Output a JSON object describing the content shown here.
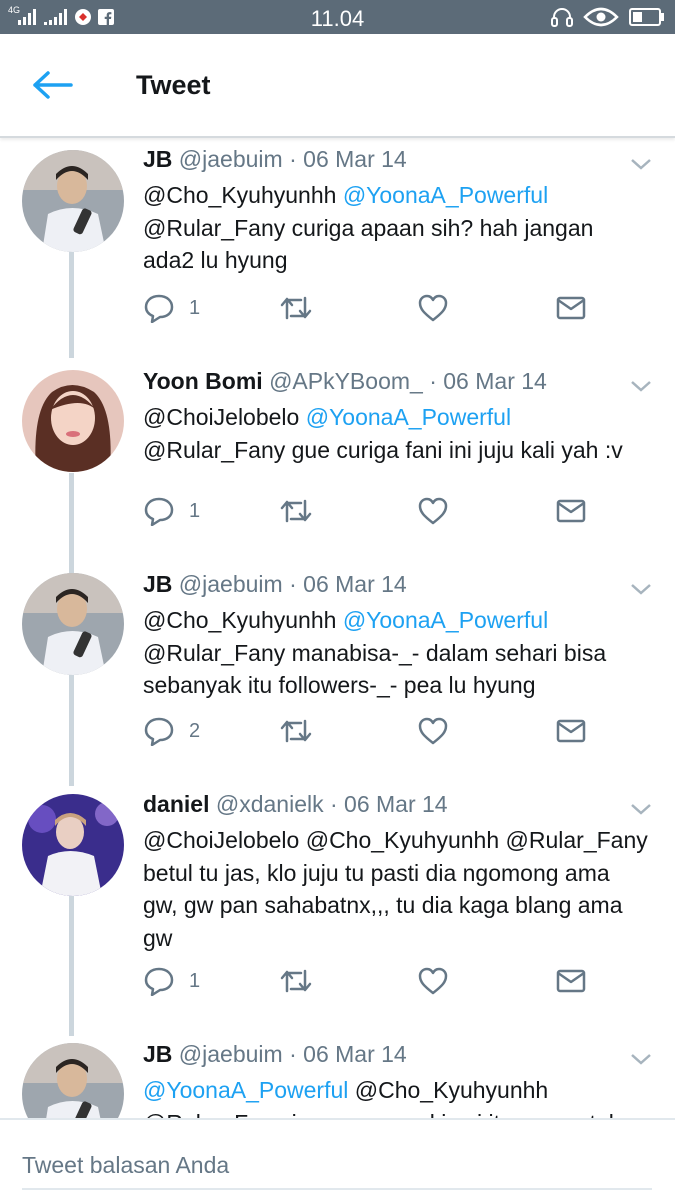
{
  "status_bar": {
    "network": "4G",
    "time": "11.04",
    "left_icons": [
      "signal-icon",
      "signal-icon",
      "vpn-icon",
      "facebook-icon"
    ],
    "right_icons": [
      "headset-icon",
      "eye-icon",
      "battery-icon"
    ]
  },
  "header": {
    "back_icon": "arrow-left-icon",
    "title": "Tweet"
  },
  "tweets": [
    {
      "name": "JB",
      "handle": "@jaebuim",
      "sep": " · ",
      "date": "06 Mar 14",
      "line1_a": "@Cho_Kyuhyunhh ",
      "line1_b": "@YoonaA_Powerful",
      "line2": "@Rular_Fany curiga apaan sih? hah jangan",
      "line3": "ada2 lu hyung",
      "reply_count": "1"
    },
    {
      "name": "Yoon Bomi",
      "handle": "@APkYBoom_",
      "sep": " · ",
      "date": "06 Mar 14",
      "line1_a": "@ChoiJelobelo ",
      "line1_b": "@YoonaA_Powerful",
      "line2": "@Rular_Fany gue curiga fani ini juju kali yah :v",
      "reply_count": "1"
    },
    {
      "name": "JB",
      "handle": "@jaebuim",
      "sep": " · ",
      "date": "06 Mar 14",
      "line1_a": "@Cho_Kyuhyunhh ",
      "line1_b": "@YoonaA_Powerful",
      "line2": "@Rular_Fany manabisa-_- dalam sehari bisa",
      "line3": "sebanyak itu followers-_- pea lu hyung",
      "reply_count": "2"
    },
    {
      "name": "daniel",
      "handle": "@xdanielk",
      "sep": " · ",
      "date": "06 Mar 14",
      "line1": "@ChoiJelobelo @Cho_Kyuhyunhh @Rular_Fany",
      "line2": "betul tu jas, klo juju tu pasti dia ngomong ama",
      "line3": "gw, gw pan sahabatnx,,, tu dia kaga blang ama",
      "line4": "gw",
      "reply_count": "1"
    },
    {
      "name": "JB",
      "handle": "@jaebuim",
      "sep": " · ",
      "date": "06 Mar 14",
      "line1_a": "@YoonaA_Powerful",
      "line1_b": " @Cho_Kyuhyunhh",
      "line2": "@Rular_Fany iya pun mungkin si item ngantuk"
    }
  ],
  "action_icons": [
    "reply-icon",
    "retweet-icon",
    "like-icon",
    "direct-message-icon"
  ],
  "reply_bar": {
    "placeholder": "Tweet balasan Anda"
  },
  "colors": {
    "status_bar": "#5c6b78",
    "accent": "#1da1f2",
    "muted": "#657786",
    "text": "#14171a",
    "thread_line": "#ccd6dd"
  }
}
